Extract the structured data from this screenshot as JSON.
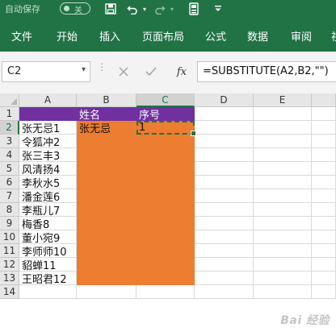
{
  "quick_access": {
    "autosave_label": "自动保存",
    "autosave_state": "关",
    "icons": [
      "save-icon",
      "undo-icon",
      "undo-dropdown-icon",
      "redo-icon",
      "redo-dropdown-icon",
      "touch-mode-icon",
      "customize-icon"
    ]
  },
  "ribbon": {
    "tabs": [
      "文件",
      "开始",
      "插入",
      "页面布局",
      "公式",
      "数据",
      "审阅",
      "视"
    ]
  },
  "formula_bar": {
    "name_box": "C2",
    "formula": "=SUBSTITUTE(A2,B2,\"\")",
    "fx_label": "fx"
  },
  "sheet": {
    "columns": [
      "A",
      "B",
      "C",
      "D",
      "E"
    ],
    "rows": [
      "1",
      "2",
      "3",
      "4",
      "5",
      "6",
      "7",
      "8",
      "9",
      "10",
      "11",
      "12",
      "13",
      "14"
    ],
    "selected_cell": "C2",
    "cells": {
      "B1": "姓名",
      "C1": "序号",
      "A2": "张无忌1",
      "B2": "张无忌",
      "C2": "1",
      "A3": "令狐冲2",
      "A4": "张三丰3",
      "A5": "风清扬4",
      "A6": "李秋水5",
      "A7": "潘金莲6",
      "A8": "李瓶儿7",
      "A9": "梅香8",
      "A10": "董小宛9",
      "A11": "李师师10",
      "A12": "貂蝉11",
      "A13": "王昭君12"
    }
  },
  "colors": {
    "ribbon": "#217346",
    "header_fill": "#7030a0",
    "data_fill": "#ed7d31"
  },
  "watermark": "Bai 经验"
}
